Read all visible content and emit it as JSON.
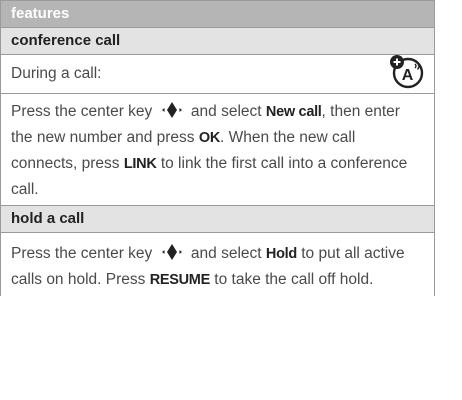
{
  "header": {
    "title": "features"
  },
  "sections": [
    {
      "title": "conference call",
      "icon": "network-feature-icon",
      "intro": "During a call:",
      "body": {
        "part1": "Press the center key",
        "part2": "and select",
        "kw1": "New call",
        "part3": ", then enter the new number and press",
        "kw2": "OK",
        "part4": ". When the new call connects, press",
        "kw3": "LINK",
        "part5": "to link the first call into a conference call."
      }
    },
    {
      "title": "hold a call",
      "body": {
        "part1": "Press the center key",
        "part2": "and select",
        "kw1": "Hold",
        "part3": "to put all active calls on hold. Press",
        "kw2": "RESUME",
        "part4": "to take the call off hold."
      }
    }
  ],
  "colors": {
    "header_bg": "#b5b5b5",
    "section_bg": "#e3e3e3",
    "text": "#4a4a4a",
    "rule": "#9a9a9a"
  }
}
